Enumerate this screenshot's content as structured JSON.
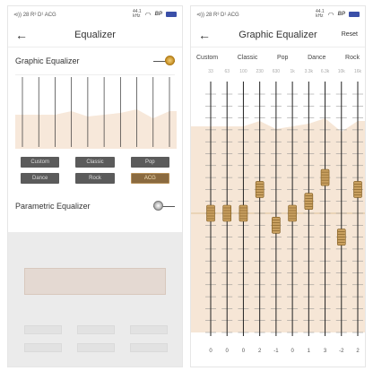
{
  "status": {
    "left_text": "⊲)) 28 R³ D¹ ACG",
    "rate_top": "44.1",
    "rate_bottom": "kHz",
    "brand": "BP",
    "wifi_icon": "wifi-icon",
    "battery_icon": "battery-icon"
  },
  "left_screen": {
    "title": "Equalizer",
    "graphic_label": "Graphic Equalizer",
    "graphic_enabled": true,
    "parametric_label": "Parametric Equalizer",
    "parametric_enabled": false,
    "presets": [
      {
        "label": "Custom",
        "active": false
      },
      {
        "label": "Classic",
        "active": false
      },
      {
        "label": "Pop",
        "active": false
      },
      {
        "label": "Dance",
        "active": false
      },
      {
        "label": "Rock",
        "active": false
      },
      {
        "label": "ACG",
        "active": true
      }
    ]
  },
  "right_screen": {
    "title": "Graphic Equalizer",
    "reset_label": "Reset",
    "tabs": [
      "Custom",
      "Classic",
      "Pop",
      "Dance",
      "Rock"
    ],
    "bands": [
      {
        "freq": "33",
        "gain": 0
      },
      {
        "freq": "63",
        "gain": 0
      },
      {
        "freq": "100",
        "gain": 0
      },
      {
        "freq": "230",
        "gain": 2
      },
      {
        "freq": "630",
        "gain": -1
      },
      {
        "freq": "1k",
        "gain": 0
      },
      {
        "freq": "3.3k",
        "gain": 1
      },
      {
        "freq": "6.3k",
        "gain": 3
      },
      {
        "freq": "10k",
        "gain": -2
      },
      {
        "freq": "16k",
        "gain": 2
      }
    ],
    "gain_range": [
      -10,
      10
    ]
  },
  "colors": {
    "accent_gold": "#c9a060",
    "curve_fill": "#f6e6d6",
    "preset_bg": "#5b5b5b",
    "preset_active_bg": "#8a6a3f"
  }
}
